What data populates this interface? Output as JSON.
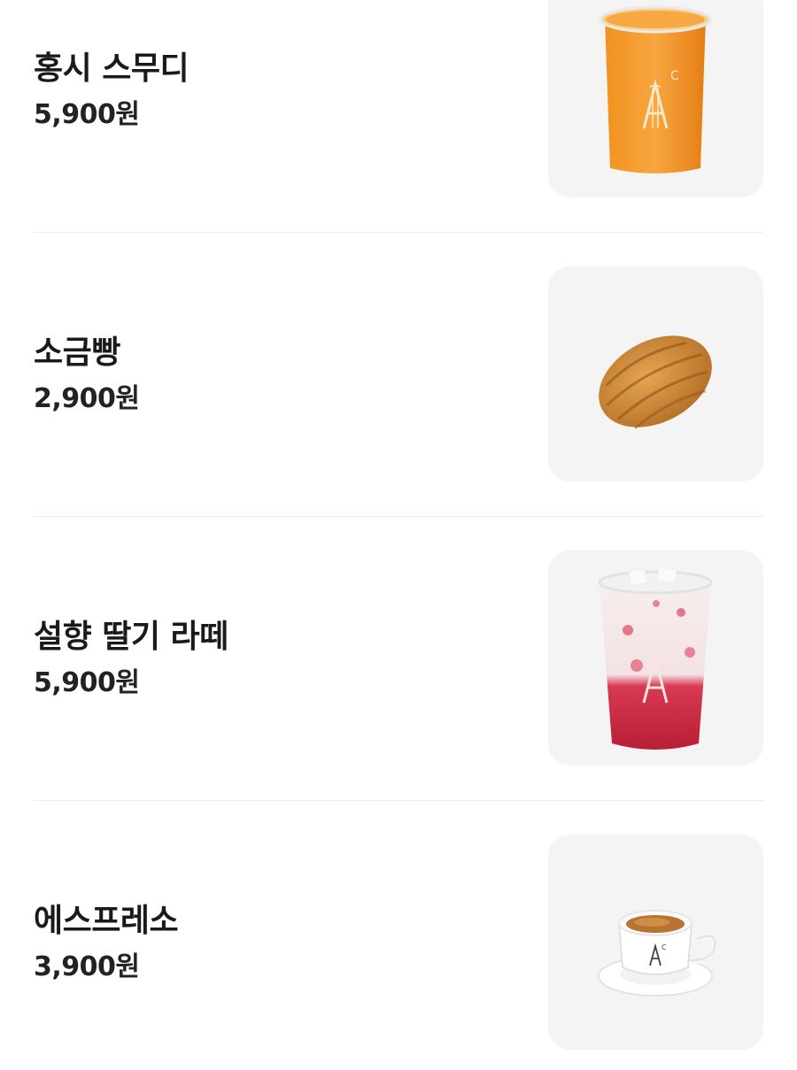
{
  "menu": {
    "items": [
      {
        "name": "홍시 스무디",
        "price": "5,900원",
        "image": "persimmon-smoothie-cup"
      },
      {
        "name": "소금빵",
        "price": "2,900원",
        "image": "salt-bread-roll"
      },
      {
        "name": "설향 딸기 라떼",
        "price": "5,900원",
        "image": "strawberry-latte-cup"
      },
      {
        "name": "에스프레소",
        "price": "3,900원",
        "image": "espresso-cup"
      }
    ]
  },
  "brand": {
    "logo_letter": "A",
    "logo_superscript": "C"
  },
  "colors": {
    "thumb_background": "#f4f4f4",
    "divider": "#ececec",
    "smoothie_orange": "#f08a1c",
    "strawberry_red": "#c8243a"
  }
}
